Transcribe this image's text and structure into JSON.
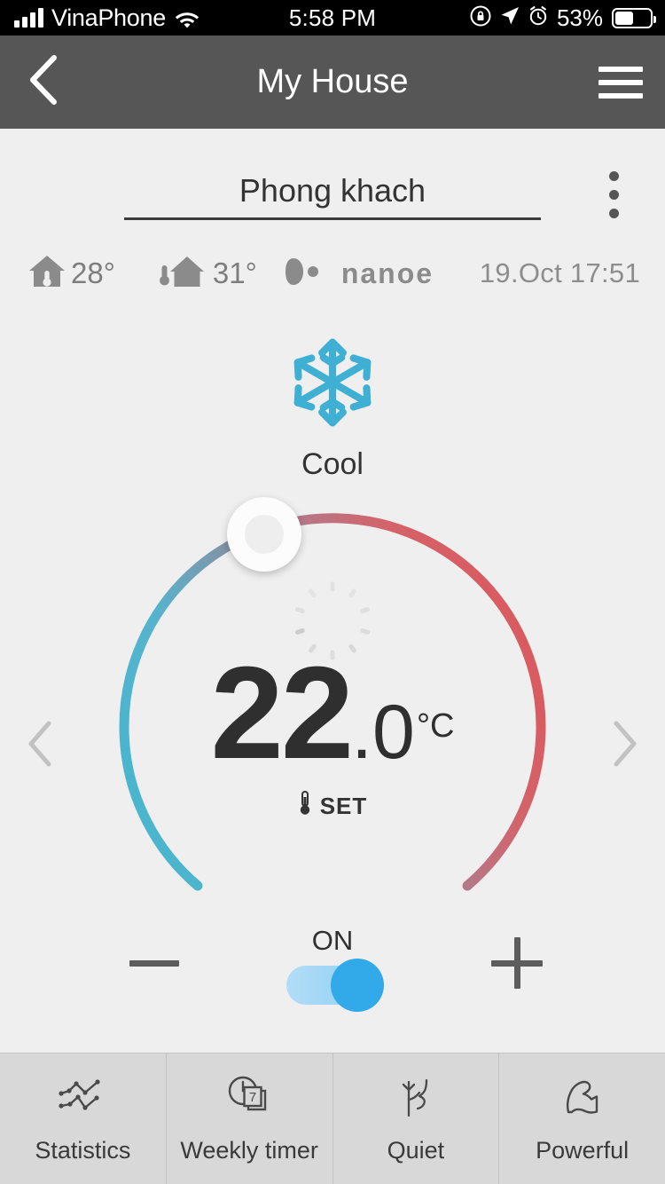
{
  "status_bar": {
    "carrier": "VinaPhone",
    "time": "5:58 PM",
    "battery_percent": "53%",
    "icons": [
      "signal-icon",
      "wifi-icon",
      "rotation-lock-icon",
      "location-arrow-icon",
      "alarm-clock-icon",
      "battery-icon"
    ]
  },
  "header": {
    "title": "My House",
    "back_icon": "chevron-left-icon",
    "menu_icon": "hamburger-menu-icon"
  },
  "room": {
    "name": "Phong khach",
    "overflow_icon": "more-vertical-icon"
  },
  "info": {
    "indoor_temp": "28°",
    "indoor_icon": "house-thermometer-inside-icon",
    "outdoor_temp": "31°",
    "outdoor_icon": "house-thermometer-outside-icon",
    "nanoe_label": "nanoe",
    "nanoe_icon": "nanoe-logo-icon",
    "timestamp": "19.Oct 17:51"
  },
  "mode": {
    "label": "Cool",
    "icon": "snowflake-icon",
    "color": "#3fb0d4"
  },
  "dial": {
    "temp_integer": "22",
    "temp_decimal": ".0",
    "unit": "°C",
    "set_label": "SET",
    "set_icon": "thermometer-icon",
    "spinner_icon": "loading-spinner-icon",
    "handle_icon": "dial-handle",
    "cool_color": "#4bb5ce",
    "heat_color": "#d9595e",
    "prev_icon": "chevron-left-icon",
    "next_icon": "chevron-right-icon"
  },
  "controls": {
    "decrease_icon": "minus-icon",
    "increase_icon": "plus-icon",
    "power_label": "ON",
    "power_state": "on",
    "power_color": "#32a9e8"
  },
  "bottom_bar": {
    "items": [
      {
        "label": "Statistics",
        "icon": "line-chart-icon"
      },
      {
        "label": "Weekly timer",
        "icon": "clock-calendar-icon"
      },
      {
        "label": "Quiet",
        "icon": "quiet-leaf-icon"
      },
      {
        "label": "Powerful",
        "icon": "flexed-bicep-icon"
      }
    ]
  }
}
